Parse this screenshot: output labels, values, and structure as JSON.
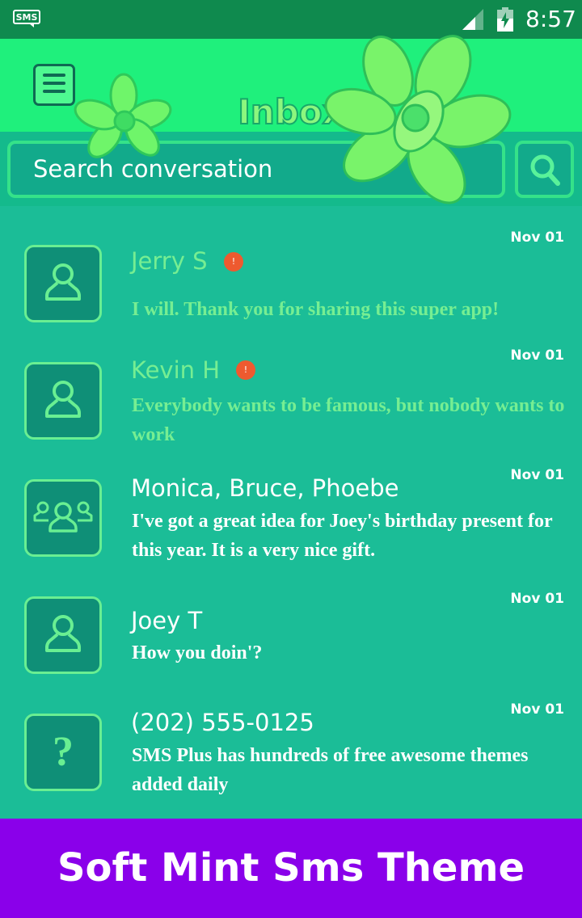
{
  "status_bar": {
    "time": "8:57",
    "notification_icon": "sms-icon",
    "signal_icon": "signal-icon",
    "battery_icon": "battery-charging-icon"
  },
  "header": {
    "title": "Inbox",
    "menu_icon": "menu-icon",
    "decoration": "mint-leaves"
  },
  "search": {
    "placeholder": "Search conversation",
    "button_icon": "search-icon"
  },
  "conversations": [
    {
      "name": "Jerry S",
      "date": "Nov 01",
      "snippet": "I will. Thank you for sharing this super app!",
      "unread": true,
      "badge": "!",
      "avatar_icon": "person-icon"
    },
    {
      "name": "Kevin H",
      "date": "Nov 01",
      "snippet": "Everybody wants to be famous, but nobody wants to work",
      "unread": true,
      "badge": "!",
      "avatar_icon": "person-icon"
    },
    {
      "name": "Monica, Bruce, Phoebe",
      "date": "Nov 01",
      "snippet": "I've got a great idea for Joey's birthday present for this year. It is a very nice gift.",
      "unread": false,
      "avatar_icon": "group-icon"
    },
    {
      "name": "Joey T",
      "date": "Nov 01",
      "snippet": "How you doin'?",
      "unread": false,
      "avatar_icon": "person-icon"
    },
    {
      "name": "(202) 555-0125",
      "date": "Nov 01",
      "snippet": "SMS Plus has hundreds of free awesome themes added daily",
      "unread": false,
      "avatar_icon": "unknown-contact-icon",
      "avatar_glyph": "?"
    }
  ],
  "banner": {
    "text": "Soft Mint Sms Theme"
  },
  "colors": {
    "status_bar": "#0f8a4e",
    "header": "#1ff07c",
    "list_background": "#1bbd97",
    "unread_text": "#76ee92",
    "badge": "#ee5a2f",
    "banner": "#8a00ea"
  }
}
